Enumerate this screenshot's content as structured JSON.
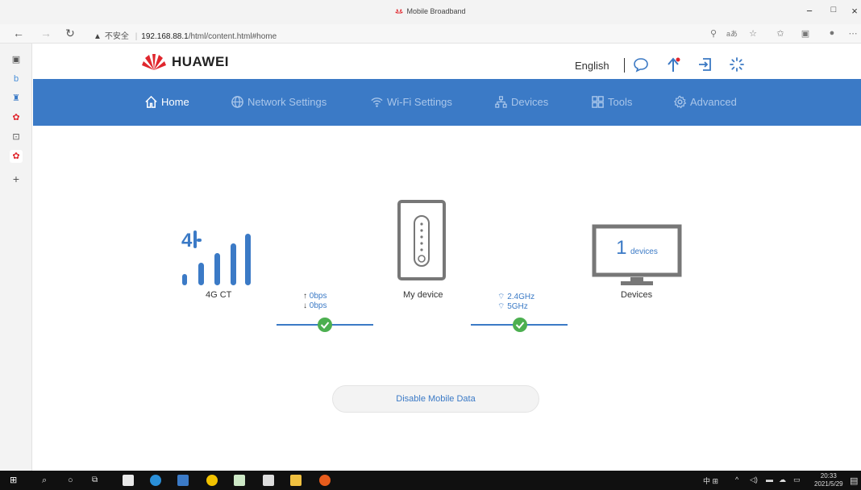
{
  "browser": {
    "tab_title": "Mobile Broadband",
    "security_label": "不安全",
    "url_host": "192.168.88.1",
    "url_path": "/html/content.html#home",
    "window_controls": {
      "minimize": "−",
      "maximize": "□",
      "close": "×"
    }
  },
  "header": {
    "brand": "HUAWEI",
    "language": "English"
  },
  "nav": {
    "items": [
      {
        "label": "Home"
      },
      {
        "label": "Network Settings"
      },
      {
        "label": "Wi-Fi Settings"
      },
      {
        "label": "Devices"
      },
      {
        "label": "Tools"
      },
      {
        "label": "Advanced"
      }
    ]
  },
  "status": {
    "network_badge": "4G CT",
    "upload_rate": "0bps",
    "download_rate": "0bps",
    "router_label": "My device",
    "wifi_band_1": "2.4GHz",
    "wifi_band_2": "5GHz",
    "device_count": "1",
    "device_count_unit": "devices",
    "devices_label": "Devices"
  },
  "actions": {
    "disable_mobile_data": "Disable Mobile Data"
  },
  "taskbar": {
    "time": "20:33",
    "date": "2021/5/29"
  },
  "colors": {
    "accent": "#3b7ac6",
    "nav_inactive": "#a9c6ea",
    "ok_green": "#4caf50",
    "brand_red": "#e0262d"
  }
}
